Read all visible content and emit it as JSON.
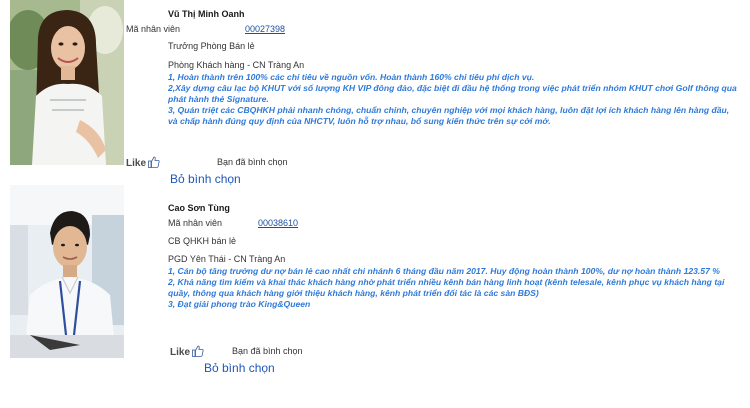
{
  "cards": [
    {
      "name": "Vũ Thị Minh Oanh",
      "employee_label": "Mã nhân viên",
      "employee_code": "00027398",
      "role": "Trưởng Phòng Bán lẻ",
      "branch": "Phòng Khách hàng - CN Tràng An",
      "achievements": [
        "1, Hoàn thành trên 100% các chỉ tiêu về nguồn vốn. Hoàn thành 160% chỉ tiêu phí dịch vụ.",
        "2,Xây dựng câu lạc bộ KHUT với số lượng KH VIP đông đảo, đặc biệt đi đầu hệ thống trong việc phát triển nhóm KHUT chơi Golf thông qua",
        "phát hành thẻ Signature.",
        "3, Quán triệt các CBQHKH phải nhanh chóng, chuẩn chỉnh, chuyên nghiệp với mọi khách hàng, luôn đặt lợi ích khách hàng lên hàng đầu,",
        "và chấp hành đúng quy định của NHCTV, luôn hỗ trợ nhau, bổ sung kiến thức trên sự cởi mở."
      ],
      "like_label": "Like",
      "voted_text": "Bạn đã bình chọn",
      "unvote_label": "Bỏ bình chọn"
    },
    {
      "name": "Cao Sơn Tùng",
      "employee_label": "Mã nhân viên",
      "employee_code": "00038610",
      "role": "CB QHKH bán lẻ",
      "branch": "PGD Yên Thái - CN Tràng An",
      "achievements": [
        "1, Cán bộ tăng trưởng dư nợ bán lẻ cao nhất chi nhánh 6 tháng đầu năm 2017. Huy động hoàn thành 100%, dư nợ hoàn thành 123.57 %",
        "2, Khả năng tìm kiếm và khai thác khách hàng nhờ phát triển nhiều kênh bán hàng linh hoạt (kênh telesale, kênh phục vụ khách hàng tại",
        "quầy, thông qua khách hàng giới thiệu khách hàng, kênh phát triển đối tác là các sàn BĐS)",
        "3, Đạt giải phong trào King&Queen"
      ],
      "like_label": "Like",
      "voted_text": "Bạn đã bình chọn",
      "unvote_label": "Bỏ bình chọn"
    }
  ],
  "icons": {
    "like": "thumbs-up-icon"
  },
  "colors": {
    "achievement_text": "#2f7ad8",
    "link": "#1f57b7",
    "code": "#1d4f9e"
  }
}
